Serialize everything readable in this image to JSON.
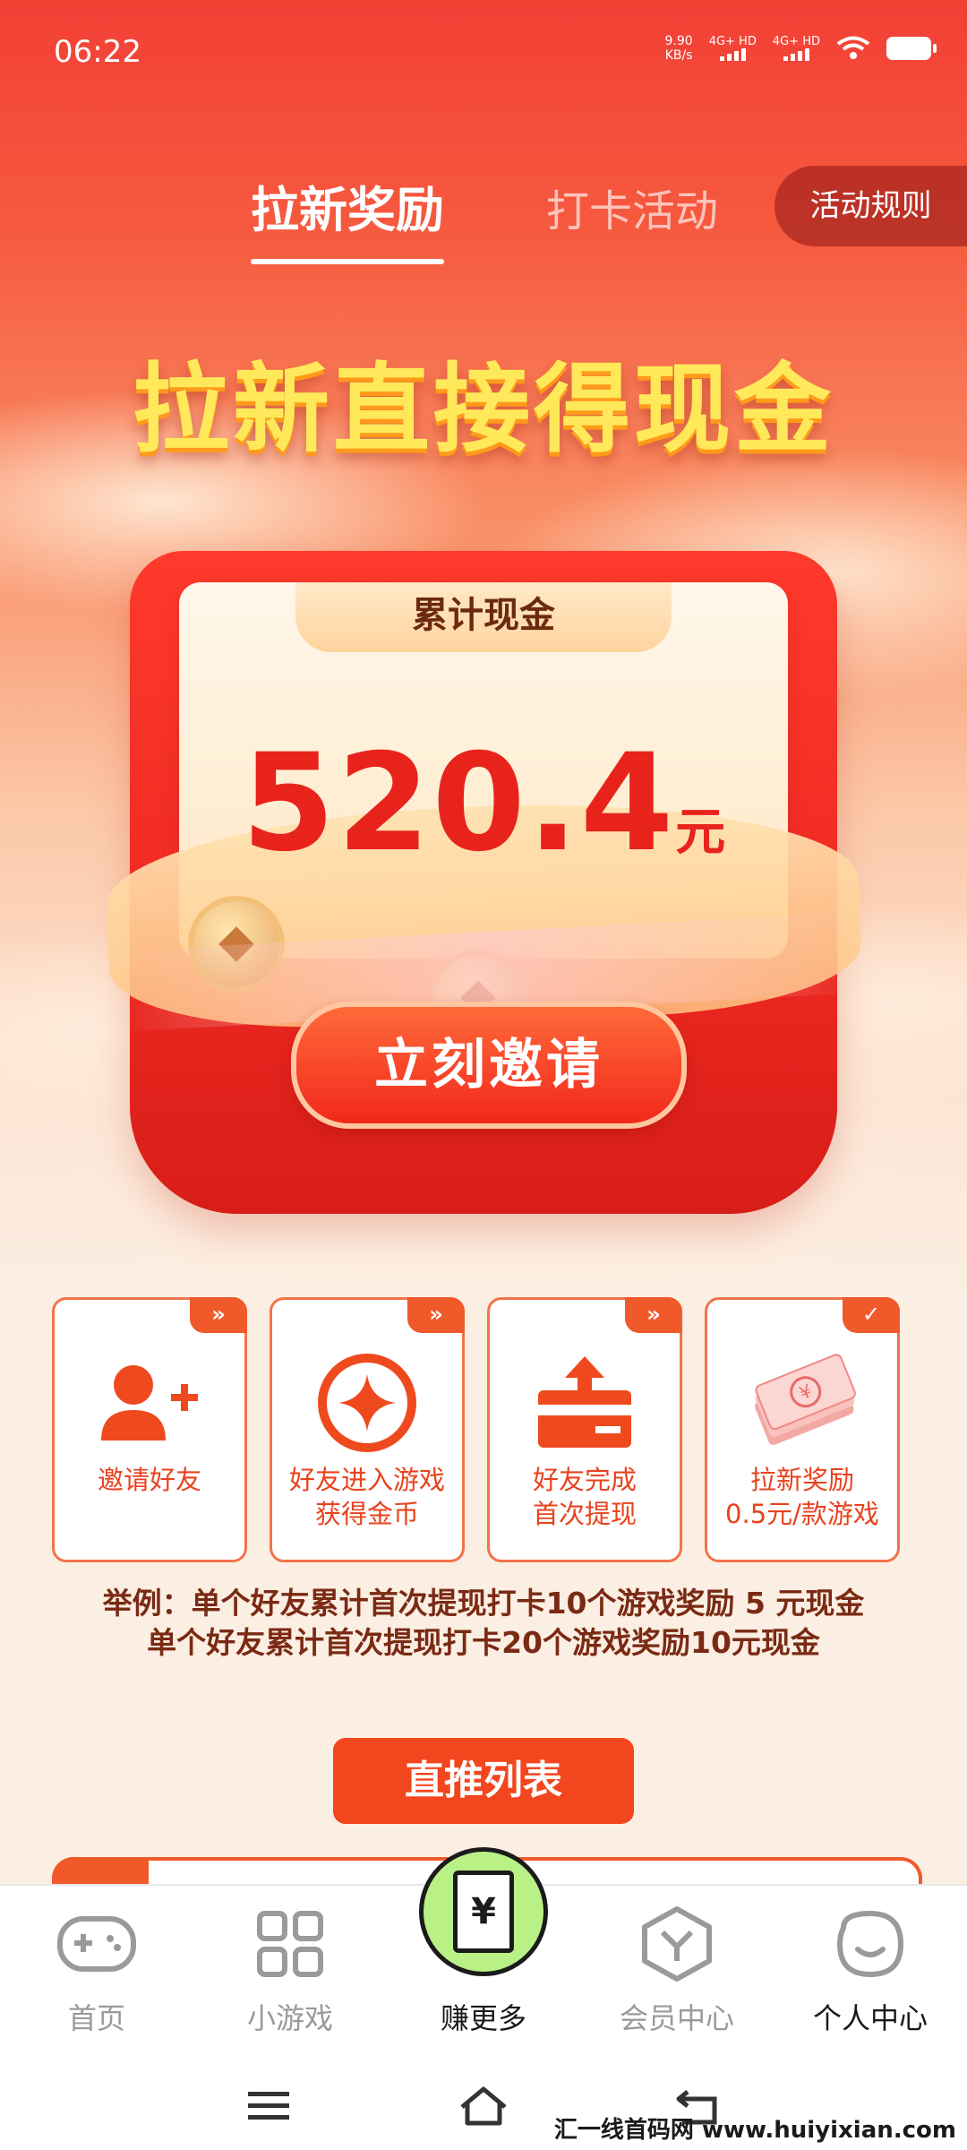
{
  "status_bar": {
    "time": "06:22",
    "speed_value": "9.90",
    "speed_unit": "KB/s",
    "network1": "4G+ HD",
    "network2": "4G+ HD"
  },
  "tabs": [
    {
      "label": "拉新奖励",
      "active": true
    },
    {
      "label": "打卡活动",
      "active": false
    }
  ],
  "rules_button": "活动规则",
  "headline": "拉新直接得现金",
  "cash_card": {
    "title": "累计现金",
    "amount": "520.4",
    "unit": "元",
    "invite_button": "立刻邀请"
  },
  "steps": [
    {
      "line1": "邀请好友",
      "line2": "",
      "badge": "»",
      "icon": "add-user-icon"
    },
    {
      "line1": "好友进入游戏",
      "line2": "获得金币",
      "badge": "»",
      "icon": "coin-icon"
    },
    {
      "line1": "好友完成",
      "line2": "首次提现",
      "badge": "»",
      "icon": "withdraw-icon"
    },
    {
      "line1": "拉新奖励",
      "line2": "0.5元/款游戏",
      "badge": "✓",
      "icon": "cash-bundle-icon"
    }
  ],
  "example": {
    "line1": "举例：单个好友累计首次提现打卡10个游戏奖励 5 元现金",
    "line2": "单个好友累计首次提现打卡20个游戏奖励10元现金"
  },
  "direct_list_button": "直推列表",
  "bottom_nav": [
    {
      "label": "首页",
      "icon": "gamepad-icon"
    },
    {
      "label": "小游戏",
      "icon": "grid-icon"
    },
    {
      "label": "赚更多",
      "icon": "yuan-icon"
    },
    {
      "label": "会员中心",
      "icon": "member-icon"
    },
    {
      "label": "个人中心",
      "icon": "smile-icon"
    }
  ],
  "watermark": "汇一线首码网 www.huiyixian.com",
  "colors": {
    "primary_red": "#f2461e",
    "amount_red": "#e8231c",
    "headline_yellow": "#ffe95a",
    "earn_green": "#b9f186"
  }
}
